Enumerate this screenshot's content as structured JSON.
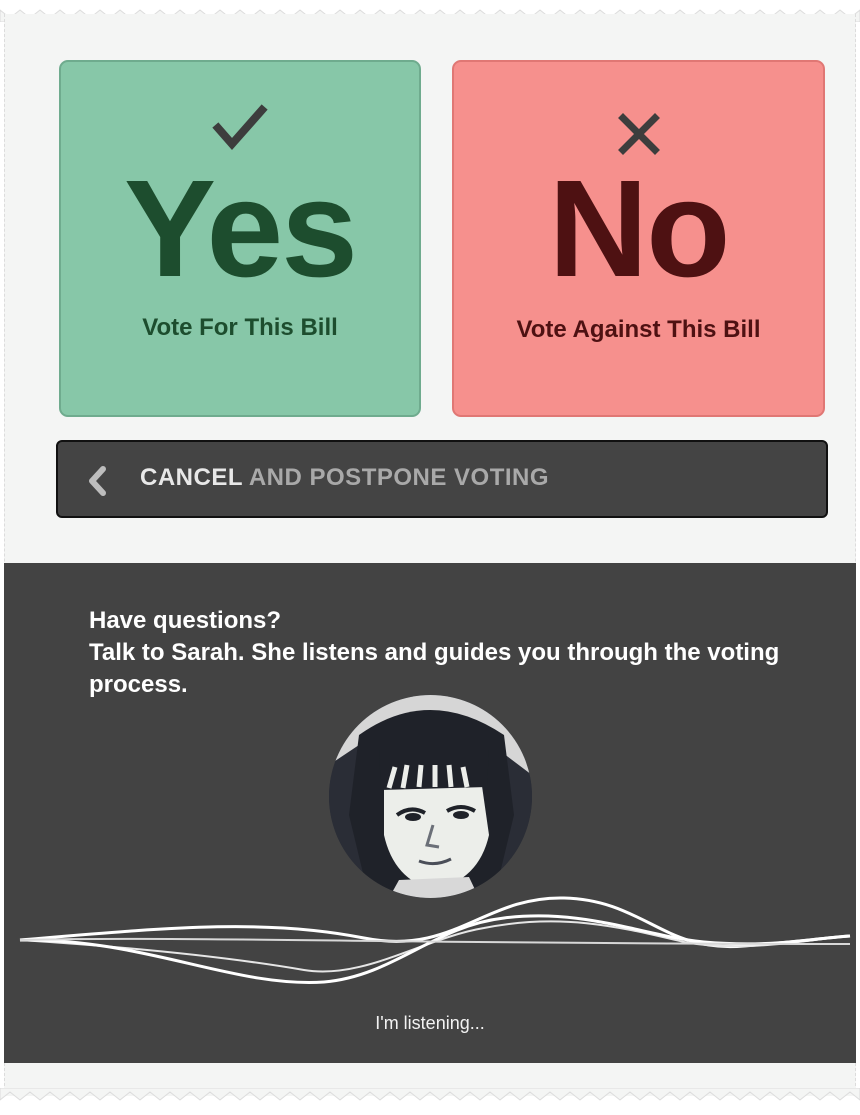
{
  "vote": {
    "yes": {
      "icon": "checkmark-icon",
      "big": "Yes",
      "sub": "Vote For This Bill",
      "color": "#87c7a8",
      "text_color": "#1d4d2e"
    },
    "no": {
      "icon": "x-icon",
      "big": "No",
      "sub": "Vote Against This Bill",
      "color": "#f6908d",
      "text_color": "#4e1112"
    }
  },
  "cancel": {
    "icon": "chevron-left-icon",
    "strong": "CANCEL",
    "rest": "AND POSTPONE VOTING"
  },
  "assistant": {
    "line1": "Have questions?",
    "line2": "Talk to Sarah. She listens and guides you through the voting process.",
    "avatar": "sarah-avatar",
    "wave_icon": "voice-waveform",
    "status": "I'm listening..."
  }
}
